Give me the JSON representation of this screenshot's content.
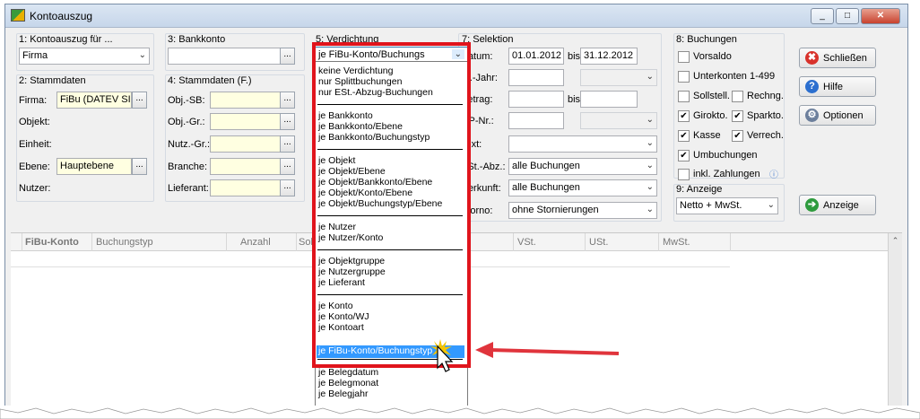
{
  "window": {
    "title": "Kontoauszug"
  },
  "g1": {
    "label": "1: Kontoauszug für ...",
    "value": "Firma"
  },
  "g3": {
    "label": "3: Bankkonto",
    "value": ""
  },
  "g2": {
    "label": "2: Stammdaten",
    "firma_label": "Firma:",
    "firma_value": "FiBu (DATEV SI",
    "objekt_label": "Objekt:",
    "einheit_label": "Einheit:",
    "ebene_label": "Ebene:",
    "ebene_value": "Hauptebene",
    "nutzer_label": "Nutzer:"
  },
  "g4": {
    "label": "4: Stammdaten (F.)",
    "fields": [
      "Obj.-SB:",
      "Obj.-Gr.:",
      "Nutz.-Gr.:",
      "Branche:",
      "Lieferant:"
    ]
  },
  "g5": {
    "label": "5: Verdichtung",
    "value": "je FiBu-Konto/Buchungs"
  },
  "g7": {
    "label": "7: Selektion",
    "datum_label": "Datum:",
    "date_from": "01.01.2012",
    "bis_label": "bis",
    "date_to": "31.12.2012",
    "wjahr_label": "W.-Jahr:",
    "betrag_label": "Betrag:",
    "betrag_bis": "bis",
    "op_label": "OP-Nr.:",
    "text_label": "Text:",
    "est_label": "ESt.-Abz.:",
    "est_value": "alle Buchungen",
    "herkunft_label": "Herkunft:",
    "herkunft_value": "alle Buchungen",
    "storno_label": "Storno:",
    "storno_value": "ohne Stornierungen"
  },
  "g8": {
    "label": "8: Buchungen",
    "checks": {
      "vorsaldo": {
        "label": "Vorsaldo",
        "checked": false
      },
      "unterkonten": {
        "label": "Unterkonten 1-499",
        "checked": false
      },
      "sollstell": {
        "label": "Sollstell.",
        "checked": false
      },
      "rechng": {
        "label": "Rechng.",
        "checked": false
      },
      "girokto": {
        "label": "Girokto.",
        "checked": true
      },
      "sparkto": {
        "label": "Sparkto.",
        "checked": true
      },
      "kasse": {
        "label": "Kasse",
        "checked": true
      },
      "verrech": {
        "label": "Verrech.",
        "checked": true
      },
      "umbuchungen": {
        "label": "Umbuchungen",
        "checked": true
      },
      "zahlungen": {
        "label": "inkl. Zahlungen",
        "checked": false
      }
    }
  },
  "g9": {
    "label": "9: Anzeige",
    "value": "Netto + MwSt."
  },
  "buttons": {
    "schliessen": "Schließen",
    "hilfe": "Hilfe",
    "optionen": "Optionen",
    "anzeige": "Anzeige"
  },
  "grid_columns": [
    "FiBu-Konto",
    "Buchungstyp",
    "Anzahl",
    "Soll",
    "VSt.",
    "USt.",
    "MwSt."
  ],
  "dropdown": {
    "items": [
      "keine Verdichtung",
      "nur Splittbuchungen",
      "nur ESt.-Abzug-Buchungen",
      "je Bankkonto",
      "je Bankkonto/Ebene",
      "je Bankkonto/Buchungstyp",
      "je Objekt",
      "je Objekt/Ebene",
      "je Objekt/Bankkonto/Ebene",
      "je Objekt/Konto/Ebene",
      "je Objekt/Buchungstyp/Ebene",
      "je Nutzer",
      "je Nutzer/Konto",
      "je Objektgruppe",
      "je Nutzergruppe",
      "je Lieferant",
      "je Konto",
      "je Konto/WJ",
      "je Kontoart",
      "je FiBu-Konto/Buchungstyp",
      "je Belegdatum",
      "je Belegmonat",
      "je Belegjahr"
    ],
    "selected": "je FiBu-Konto/Buchungstyp"
  },
  "colors": {
    "highlight_box": "#e0141c",
    "arrow": "#e0343c",
    "selection": "#3399ff"
  }
}
